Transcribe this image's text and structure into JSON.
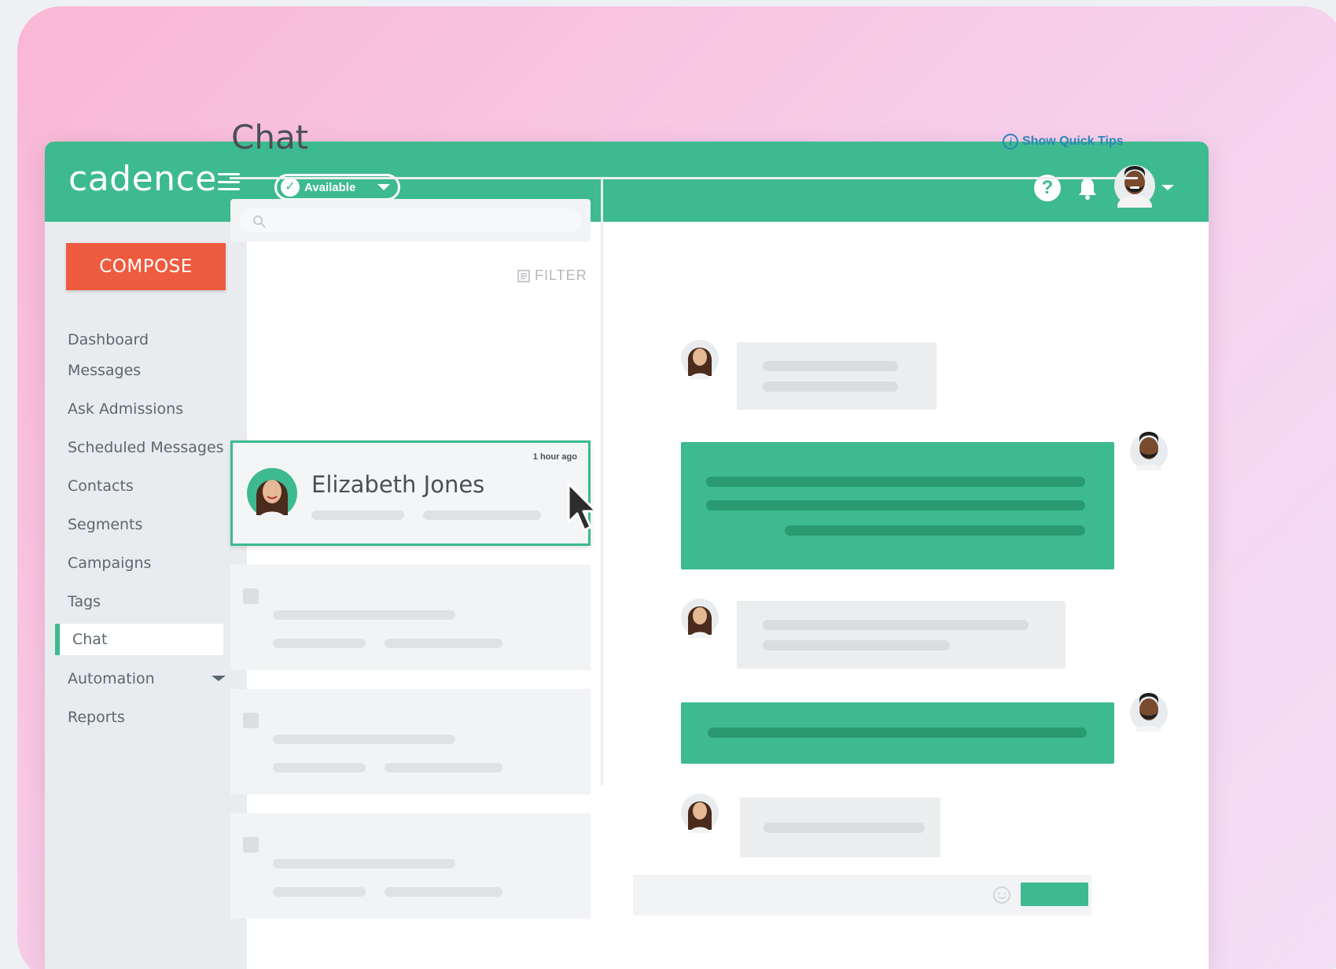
{
  "header": {
    "logo": "cadence",
    "status": "Available"
  },
  "sidebar": {
    "compose_label": "COMPOSE",
    "items": [
      {
        "label": "Dashboard"
      },
      {
        "label": "Messages"
      },
      {
        "label": "Ask Admissions"
      },
      {
        "label": "Scheduled Messages"
      },
      {
        "label": "Contacts"
      },
      {
        "label": "Segments"
      },
      {
        "label": "Campaigns"
      },
      {
        "label": "Tags"
      },
      {
        "label": "Chat",
        "active": true
      },
      {
        "label": "Automation",
        "has_dropdown": true
      },
      {
        "label": "Reports"
      }
    ]
  },
  "main": {
    "title": "Chat",
    "quick_tips": "Show Quick Tips",
    "filter_label": "FILTER",
    "conversations": [
      {
        "name": "Elizabeth Jones",
        "time": "1 hour ago",
        "selected": true
      }
    ]
  },
  "colors": {
    "brand": "#3dba8f",
    "compose": "#ef5b3f",
    "link": "#2f86b8"
  }
}
